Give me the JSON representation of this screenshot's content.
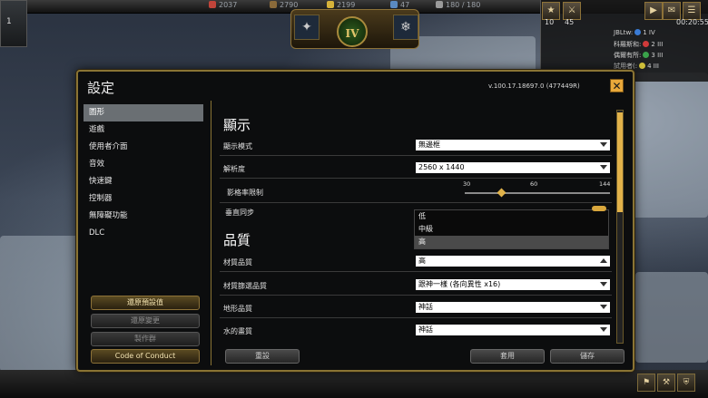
{
  "hud": {
    "resources": [
      "2037",
      "2790",
      "2199",
      "47",
      "180 / 180"
    ],
    "age": "IV",
    "top_left_count": "1",
    "population_left": "10",
    "population_right": "45",
    "clock": "00:20:55",
    "scores": [
      {
        "name": "JBLtw:",
        "rank": "1",
        "age": "IV",
        "color": "#3a7bd5"
      },
      {
        "name": "科羅斯和:",
        "rank": "2",
        "age": "III",
        "color": "#d03a3a"
      },
      {
        "name": "偶爾有所:",
        "rank": "3",
        "age": "III",
        "color": "#3aa24a"
      },
      {
        "name": "試用者(:",
        "rank": "4",
        "age": "III",
        "color": "#d0c03a"
      }
    ]
  },
  "dialog": {
    "title": "設定",
    "version": "v.100.17.18697.0 (477449R)",
    "close": "✕"
  },
  "sidebar": {
    "items": [
      {
        "label": "圖形",
        "active": true
      },
      {
        "label": "遊戲"
      },
      {
        "label": "使用者介面"
      },
      {
        "label": "音效"
      },
      {
        "label": "快速鍵"
      },
      {
        "label": "控制器"
      },
      {
        "label": "無障礙功能"
      },
      {
        "label": "DLC"
      }
    ],
    "buttons": {
      "restore_defaults": "還原預設值",
      "revert_changes": "還原變更",
      "credits": "製作群",
      "code_of_conduct": "Code of Conduct"
    }
  },
  "display": {
    "section_title": "顯示",
    "display_mode_label": "顯示模式",
    "display_mode_value": "無邊框",
    "resolution_label": "解析度",
    "resolution_value": "2560 x 1440",
    "frame_limit_label": "影格率限制",
    "frame_limit_ticks": [
      "30",
      "60",
      "144"
    ],
    "frame_limit_value": 60,
    "vsync_label": "垂直同步"
  },
  "quality": {
    "section_title": "品質",
    "texture_label": "材質品質",
    "texture_value": "高",
    "texture_options": [
      "低",
      "中級",
      "高"
    ],
    "filtering_label": "材質篩選品質",
    "filtering_value": "跟神一樣 (各向異性 x16)",
    "terrain_label": "地形品質",
    "terrain_value": "神話",
    "water_label": "水的畫質",
    "water_value": "神話"
  },
  "footer": {
    "reset": "重設",
    "apply": "套用",
    "save": "儲存"
  }
}
